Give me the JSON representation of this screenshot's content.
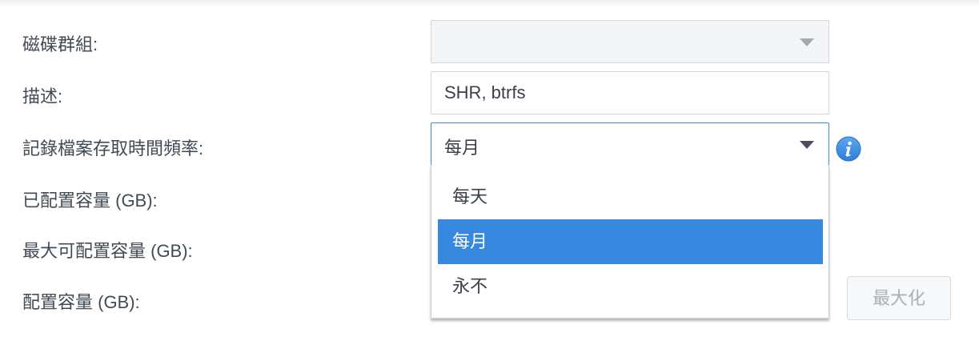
{
  "form": {
    "volume_label": "磁碟群組:",
    "volume_value": "",
    "description_label": "描述:",
    "description_value": "SHR, btrfs",
    "access_time_label": "記錄檔案存取時間頻率:",
    "access_time_value": "每月",
    "allocated_label": "已配置容量 (GB):",
    "max_label": "最大可配置容量 (GB):",
    "capacity_label": "配置容量 (GB):",
    "maximize_button": "最大化"
  },
  "dropdown": {
    "options": [
      "每天",
      "每月",
      "永不"
    ],
    "selected": "每月"
  },
  "colors": {
    "accent": "#3689df",
    "info_icon": "#3a8ee6",
    "label_text": "#414b55"
  },
  "icons": {
    "info": "info-icon",
    "dropdown_caret": "chevron-down-icon"
  }
}
